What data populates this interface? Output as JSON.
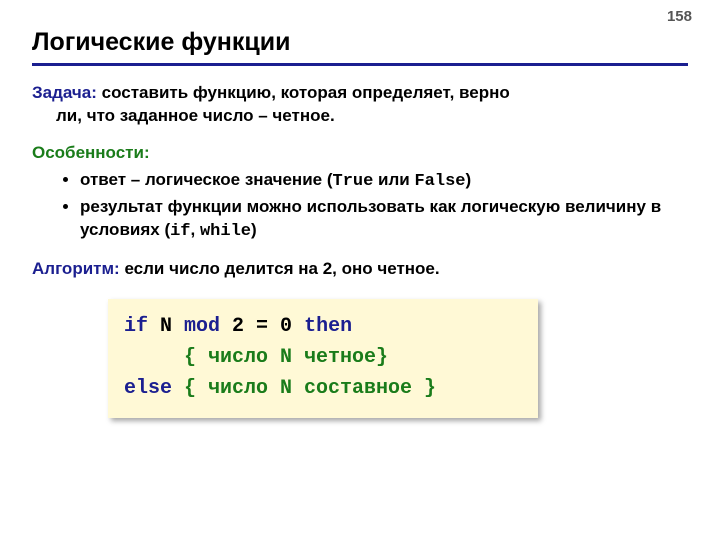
{
  "pageNumber": "158",
  "title": "Логические функции",
  "task": {
    "label": "Задача:",
    "line1": " составить функцию, которая определяет, верно",
    "line2": "ли, что заданное число – четное."
  },
  "features": {
    "label": "Особенности:",
    "bullets": [
      {
        "pre": "ответ – логическое значение (",
        "m1": "True",
        "mid": " или ",
        "m2": "False",
        "post": ")"
      },
      {
        "pre": "результат функции можно использовать как логическую величину в условиях (",
        "m1": "if",
        "mid": ", ",
        "m2": "while",
        "post": ")"
      }
    ]
  },
  "algo": {
    "label": "Алгоритм:",
    "text": " если число делится на 2, оно четное."
  },
  "code": {
    "l1a": "if",
    "l1b": " N ",
    "l1c": "mod",
    "l1d": " 2 = 0 ",
    "l1e": "then",
    "l2": "     { число N четное}",
    "l3a": "else",
    "l3b": " { число N составное }"
  }
}
